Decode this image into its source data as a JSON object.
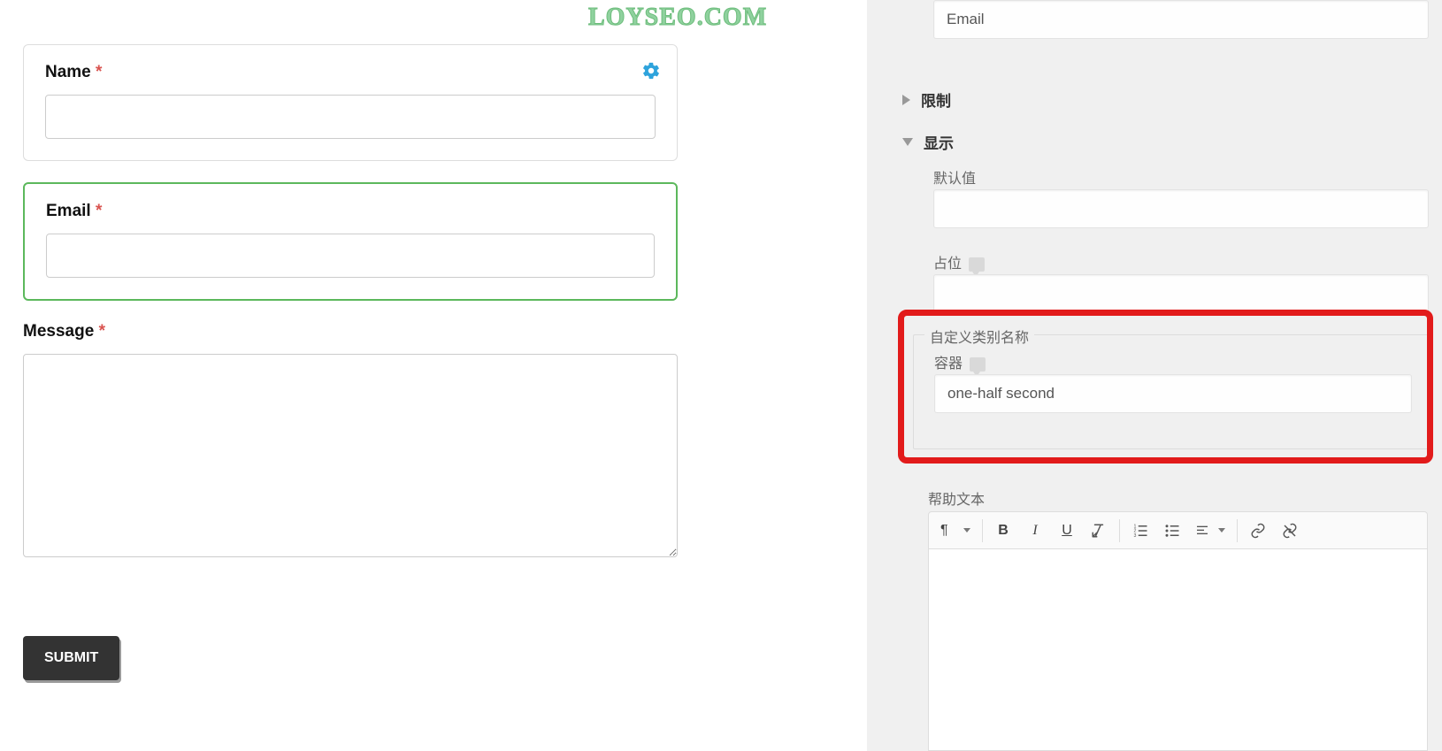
{
  "watermark": "LOYSEO.COM",
  "form": {
    "name": {
      "label": "Name",
      "required": true
    },
    "email": {
      "label": "Email",
      "required": true
    },
    "message": {
      "label": "Message",
      "required": true
    },
    "submit_label": "SUBMIT"
  },
  "panel": {
    "top_field_value": "Email",
    "sections": {
      "restrict": "限制",
      "display": "显示"
    },
    "default_value": {
      "label": "默认值",
      "value": ""
    },
    "placeholder": {
      "label": "占位",
      "value": ""
    },
    "custom_class": {
      "legend": "自定义类别名称",
      "container_label": "容器",
      "container_value": "one-half second"
    },
    "help_text_label": "帮助文本"
  },
  "toolbar": {
    "pilcrow": "¶",
    "bold": "B",
    "italic": "I",
    "underline": "U"
  }
}
